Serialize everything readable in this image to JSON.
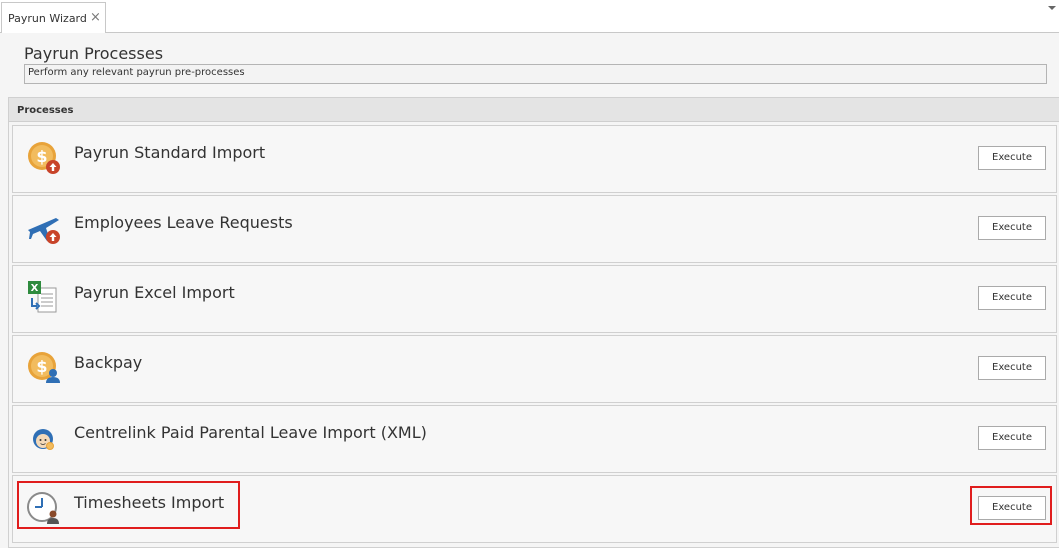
{
  "tab": {
    "label": "Payrun Wizard",
    "close_glyph": "×"
  },
  "page": {
    "title": "Payrun Processes",
    "description": "Perform any relevant payrun pre-processes"
  },
  "group": {
    "label": "Processes"
  },
  "processes": [
    {
      "title": "Payrun Standard Import",
      "button": "Execute",
      "icon": "dollar-import-icon"
    },
    {
      "title": "Employees Leave Requests",
      "button": "Execute",
      "icon": "plane-import-icon"
    },
    {
      "title": "Payrun Excel Import",
      "button": "Execute",
      "icon": "excel-import-icon"
    },
    {
      "title": "Backpay",
      "button": "Execute",
      "icon": "dollar-person-icon"
    },
    {
      "title": "Centrelink Paid Parental Leave Import (XML)",
      "button": "Execute",
      "icon": "baby-icon"
    },
    {
      "title": "Timesheets Import",
      "button": "Execute",
      "icon": "clock-person-icon"
    }
  ],
  "colors": {
    "highlight": "#e01d1d",
    "accent_orange": "#e8a33a",
    "accent_red": "#d34a2a",
    "accent_blue": "#2f6fb5",
    "accent_green": "#2e8b3e"
  }
}
